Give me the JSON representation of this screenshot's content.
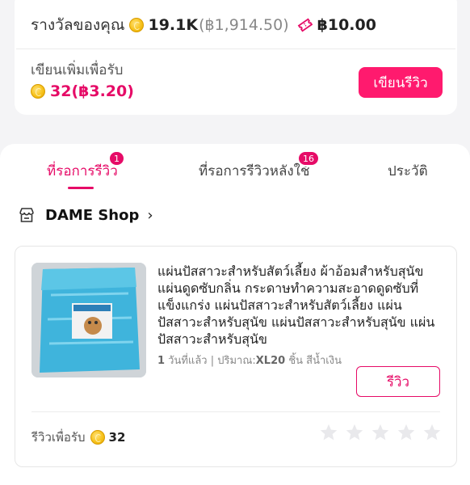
{
  "reward": {
    "label": "รางวัลของคุณ",
    "coins": "19.1K",
    "coins_baht": "(฿1,914.50)",
    "voucher_value": "฿10.00"
  },
  "write_more": {
    "label": "เขียนเพิ่มเพื่อรับ",
    "earn": "32(฿3.20)",
    "button": "เขียนรีวิว"
  },
  "tabs": [
    {
      "label": "ที่รอการรีวิว",
      "badge": "1",
      "active": true
    },
    {
      "label": "ที่รอการรีวิวหลังใช้",
      "badge": "16",
      "active": false
    },
    {
      "label": "ประวัติ",
      "badge": "",
      "active": false
    }
  ],
  "shop": {
    "name": "DAME Shop",
    "icon": "store-icon"
  },
  "product": {
    "name": "แผ่นปัสสาวะสำหรับสัตว์เลี้ยง ผ้าอ้อมสำหรับสุนัข แผ่นดูดซับกลิ่น กระดาษทำความสะอาดดูดซับที่แข็งแกร่ง แผ่นปัสสาวะสำหรับสัตว์เลี้ยง แผ่นปัสสาวะสำหรับสุนัข แผ่นปัสสาวะสำหรับสุนัข แผ่นปัสสาวะสำหรับสุนัข",
    "meta_count": "1",
    "meta_text": " วันที่แล้ว | ปริมาณ:",
    "meta_variant": "XL20",
    "meta_tail": " ชิ้น สีน้ำเงิน",
    "review_button": "รีวิว",
    "earn_label": "รีวิวเพื่อรับ",
    "earn_points": "32",
    "stars": 0
  },
  "colors": {
    "accent": "#e60b67",
    "button": "#ff1a6e"
  }
}
